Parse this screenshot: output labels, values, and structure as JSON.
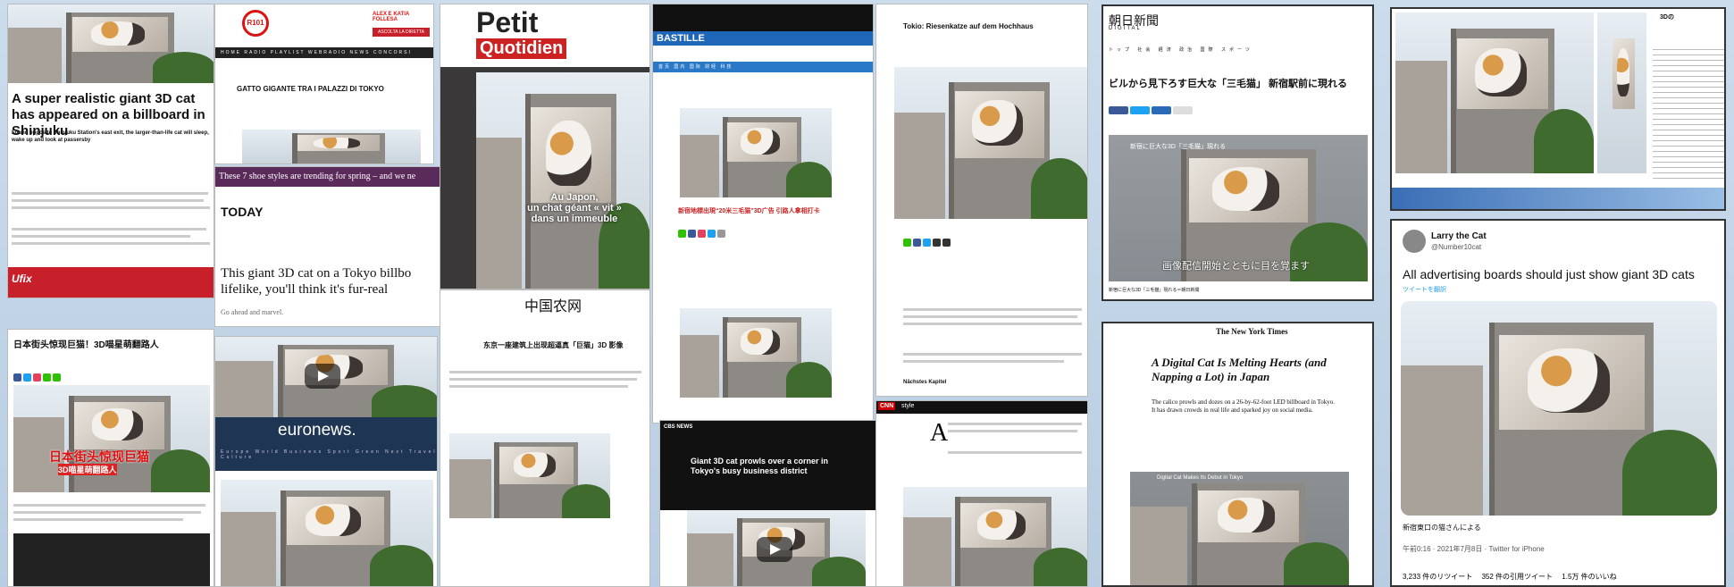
{
  "cards": {
    "c1": {
      "title": "A super realistic giant 3D cat has appeared on a billboard in Shinjuku",
      "sub": "Found opposite Shinjuku Station's east exit, the larger-than-life cat will sleep, wake up and look at passersby"
    },
    "c2": {
      "logo": "R101",
      "brand_tag": "ALEX E KATIA FOLLESA",
      "banner": "ASCOLTA LA DIRETTA",
      "title": "GATTO GIGANTE TRA I PALAZZI DI TOKYO"
    },
    "c3": {
      "logo1": "Petit",
      "logo2": "Quotidien",
      "fr1": "Au Japon,",
      "fr2": "un chat géant « vit »",
      "fr3": "dans un immeuble"
    },
    "c4": {
      "headline": "These 7 shoe styles are trending for spring – and we ne",
      "logo": "TODAY",
      "title": "This giant 3D cat on a Tokyo billbo lifelike, you'll think it's fur-real",
      "sub": "Go ahead and marvel."
    },
    "c5": {
      "logo": "BASTILLE",
      "title": "新宿地標出現“20米三毛猫”3D广告 引路人拿相打卡"
    },
    "c6": {
      "title": "Tokio: Riesenkatze auf dem Hochhaus",
      "note": "Nächstes Kapitel"
    },
    "c7": {
      "logo": "朝日新聞",
      "logo_sub": "DIGITAL",
      "title": "ビルから見下ろす巨大な「三毛猫」 新宿駅前に現れる",
      "video_caption": "新宿に巨大な3D「三毛猫」現れる",
      "video_sub": "画像配信開始とともに目を覚ます",
      "caption": "新宿に巨大な3D「三毛猫」現れる＝朝日新聞"
    },
    "c8": {
      "head1": "3Dの"
    },
    "c9": {
      "logo": "The New York Times",
      "title": "A Digital Cat Is Melting Hearts (and Napping a Lot) in Japan",
      "sub": "The calico prowls and dozes on a 26-by-62-foot LED billboard in Tokyo. It has drawn crowds in real life and sparked joy on social media.",
      "video_label": "Digital Cat Makes Its Debut in Tokyo"
    },
    "c10": {
      "name": "Larry the Cat",
      "handle": "@Number10cat",
      "tweet": "All advertising boards should just show giant 3D cats",
      "translate": "ツイートを翻訳",
      "credit": "新宿東口の猫さんによる",
      "time": "午前0:16 · 2021年7月8日 · Twitter for iPhone",
      "retweets": "3,233 件のリツイート",
      "quotes": "352 件の引用ツイート",
      "likes": "1.5万 件のいいね"
    },
    "c11": {
      "title": "日本街头惊现巨猫！3D喵星萌翻路人",
      "banner1": "日本街头惊现巨猫",
      "banner2": "3D喵星萌翻路人"
    },
    "c12": {
      "logo": "euronews."
    },
    "c13": {
      "logo": "中国农网",
      "title": "东京一座建筑上出现超逼真「巨猫」3D 影像"
    },
    "c14": {
      "brand": "CBS NEWS",
      "title": "Giant 3D cat prowls over a corner in Tokyo's busy business district"
    },
    "c15": {
      "brand": "CNN",
      "brand2": "style"
    },
    "c16": {
      "logo": "Ufix"
    }
  }
}
